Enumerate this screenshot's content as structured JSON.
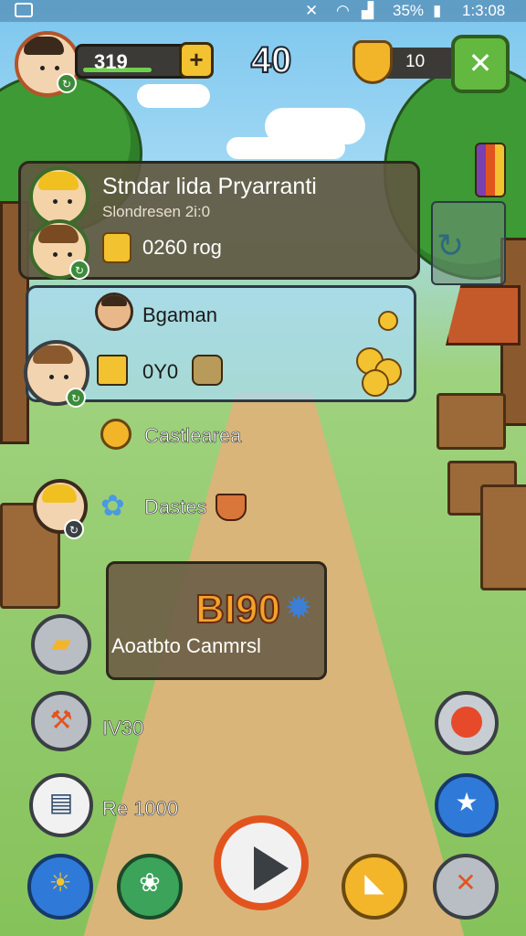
{
  "status_bar": {
    "battery": "35%",
    "time": "1:3:08"
  },
  "hud": {
    "xp_value": "319",
    "xp_fill": 0.55,
    "plus_label": "+",
    "center_count": "40",
    "shield_value": "10"
  },
  "panel_top": {
    "title": "Stndar lida Pryarranti",
    "subtitle": "Slondresen 2i:0",
    "value": "0260 rog"
  },
  "panel_second": {
    "name": "Bgaman",
    "value": "0Y0"
  },
  "list": {
    "item1": "Castlearea",
    "item2": "Dastes"
  },
  "panel_mid": {
    "headline": "BI90",
    "caption": "Aoatbto Canmrsl"
  },
  "side_buttons": {
    "label1": "IV30",
    "label2": "Re 1000"
  },
  "icons": {
    "top_right": "crossed-swords-icon",
    "settings": "sun-gear-icon",
    "play": "play-icon",
    "star": "star-icon",
    "record": "record-icon"
  },
  "colors": {
    "accent_orange": "#e2541e",
    "accent_gold": "#f2c230",
    "accent_green": "#63b840",
    "accent_blue": "#2f7ad8"
  }
}
